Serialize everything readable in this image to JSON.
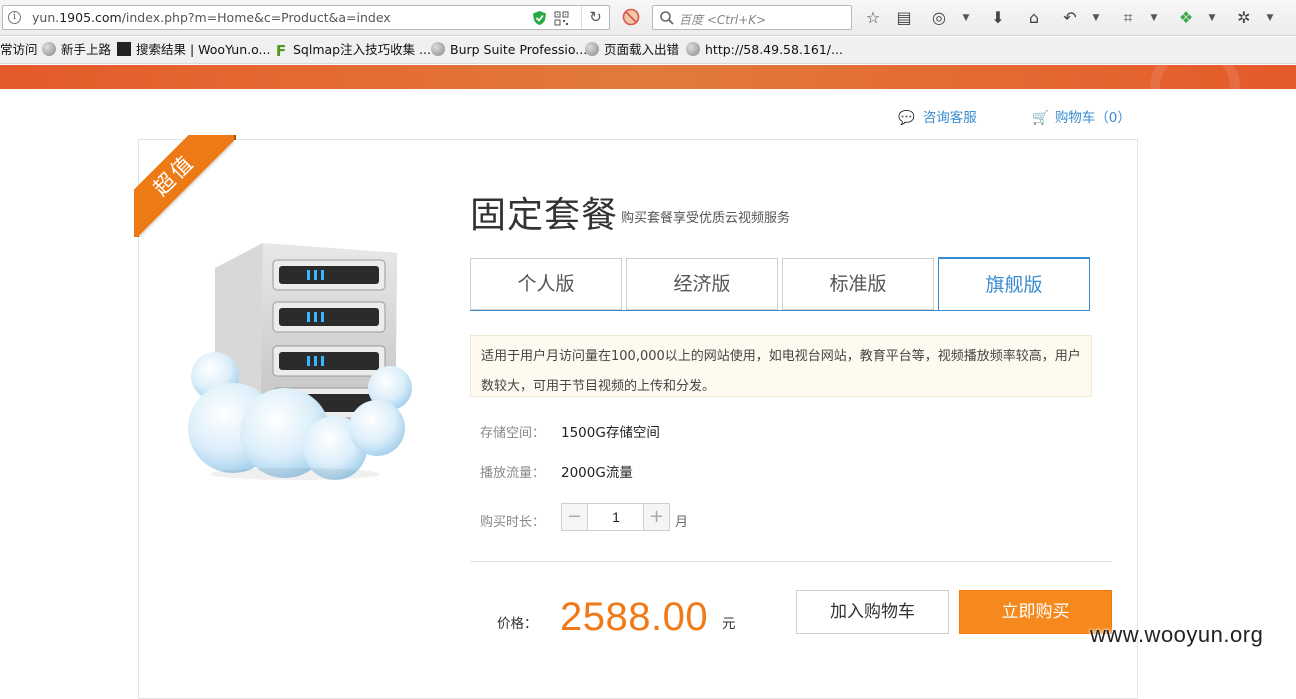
{
  "browser": {
    "url_prefix": "yun.",
    "url_domain": "1905.com",
    "url_path": "/index.php?m=Home&c=Product&a=index",
    "search_placeholder": "百度 <Ctrl+K>"
  },
  "bookmarks": [
    {
      "label": "常访问",
      "icon": "none"
    },
    {
      "label": "新手上路",
      "icon": "globe-icon"
    },
    {
      "label": "搜索结果 | WooYun.o...",
      "icon": "wooyun-icon"
    },
    {
      "label": "Sqlmap注入技巧收集 ...",
      "icon": "f-icon"
    },
    {
      "label": "Burp Suite Professio...",
      "icon": "globe-icon"
    },
    {
      "label": "页面载入出错",
      "icon": "globe-icon"
    },
    {
      "label": "http://58.49.58.161/...",
      "icon": "globe-icon"
    }
  ],
  "toplinks": {
    "consult": "咨询客服",
    "cart": "购物车（0）"
  },
  "product": {
    "badge": "超值",
    "title": "固定套餐",
    "subtitle": "购买套餐享受优质云视频服务",
    "tabs": [
      {
        "label": "个人版",
        "active": false
      },
      {
        "label": "经济版",
        "active": false
      },
      {
        "label": "标准版",
        "active": false
      },
      {
        "label": "旗舰版",
        "active": true
      }
    ],
    "description": "适用于用户月访问量在100,000以上的网站使用，如电视台网站，教育平台等，视频播放频率较高，用户数较大，可用于节目视频的上传和分发。",
    "storage_label": "存储空间：",
    "storage_value": "1500G存储空间",
    "traffic_label": "播放流量：",
    "traffic_value": "2000G流量",
    "duration_label": "购买时长：",
    "quantity": "1",
    "unit": "月",
    "price_label": "价格：",
    "price": "2588.00",
    "currency": "元",
    "add_cart_label": "加入购物车",
    "buy_now_label": "立即购买"
  },
  "colors": {
    "accent_blue": "#3a8cd0",
    "accent_orange": "#f07a18",
    "header_orange": "#e45a2a"
  },
  "watermark": "www.wooyun.org"
}
